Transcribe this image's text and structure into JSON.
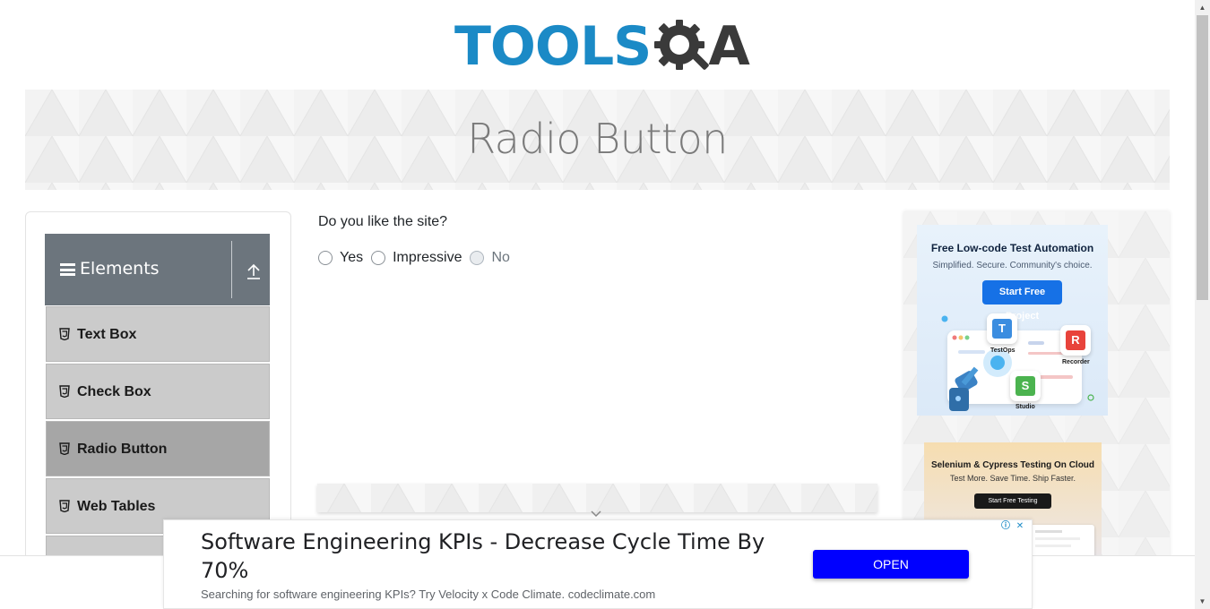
{
  "header": {
    "logo_text_left": "TOOLS",
    "logo_text_right": "A"
  },
  "banner": {
    "title": "Radio Button"
  },
  "sidebar": {
    "group_title": "Elements",
    "items": [
      {
        "label": "Text Box",
        "active": false
      },
      {
        "label": "Check Box",
        "active": false
      },
      {
        "label": "Radio Button",
        "active": true
      },
      {
        "label": "Web Tables",
        "active": false
      }
    ]
  },
  "main": {
    "question": "Do you like the site?",
    "options": [
      {
        "label": "Yes",
        "disabled": false
      },
      {
        "label": "Impressive",
        "disabled": false
      },
      {
        "label": "No",
        "disabled": true
      }
    ]
  },
  "ads": {
    "ad1": {
      "headline": "Free Low-code Test Automation",
      "subline": "Simplified. Secure. Community's choice.",
      "button": "Start Free Project",
      "tiles": [
        "TestOps",
        "Recorder",
        "Studio"
      ]
    },
    "ad2": {
      "headline": "Selenium & Cypress Testing On Cloud",
      "subline": "Test More. Save Time. Ship Faster.",
      "button": "Start Free Testing"
    },
    "bottom": {
      "headline": "Software Engineering KPIs - Decrease Cycle Time By 70%",
      "subline": "Searching for software engineering KPIs? Try Velocity x Code Climate. codeclimate.com",
      "button": "OPEN"
    }
  },
  "colors": {
    "brand_blue": "#1b8ac6",
    "brand_dark": "#3a3a3a",
    "sidebar_header": "#6c757d",
    "menu_item": "#cbcbcb",
    "menu_item_active": "#a6a6a6",
    "ad_open_button": "#0000ff"
  }
}
